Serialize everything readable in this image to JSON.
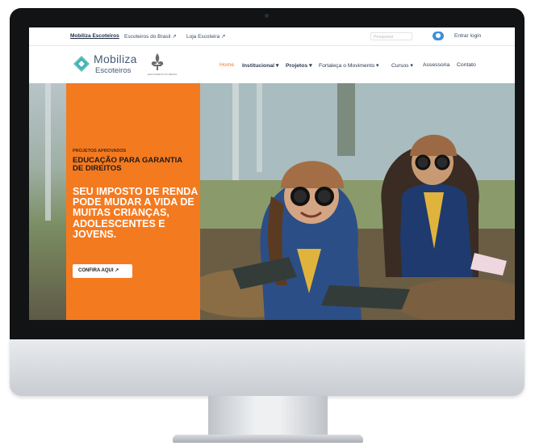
{
  "topbar": {
    "links": [
      {
        "label": "Mobiliza Escoteiros"
      },
      {
        "label": "Escoteiros do Brasil"
      },
      {
        "label": "Loja Escoteira"
      }
    ],
    "search_placeholder": "Pesquisar",
    "login_label": "Entrar login"
  },
  "brand": {
    "name": "Mobiliza",
    "sub": "Escoteiros",
    "org_label": "ESCOTEIROS DO BRASIL"
  },
  "menu": {
    "items": [
      {
        "label": "Home"
      },
      {
        "label": "Institucional ▾"
      },
      {
        "label": "Projetos ▾"
      },
      {
        "label": "Fortaleça o Movimento ▾"
      },
      {
        "label": "Cursos ▾"
      },
      {
        "label": "Assessoria"
      },
      {
        "label": "Contato"
      }
    ]
  },
  "hero": {
    "kicker": "PROJETOS APROVADOS",
    "title": "EDUCAÇÃO PARA GARANTIA DE DIREITOS",
    "headline": "SEU IMPOSTO DE RENDA PODE MUDAR A VIDA DE MUITAS CRIANÇAS, ADOLESCENTES E JOVENS.",
    "cta_label": "CONFIRA AQUI ↗"
  },
  "colors": {
    "accent": "#f47a20",
    "nav_text": "#2d3a52",
    "login_button": "#3f8fd8"
  }
}
